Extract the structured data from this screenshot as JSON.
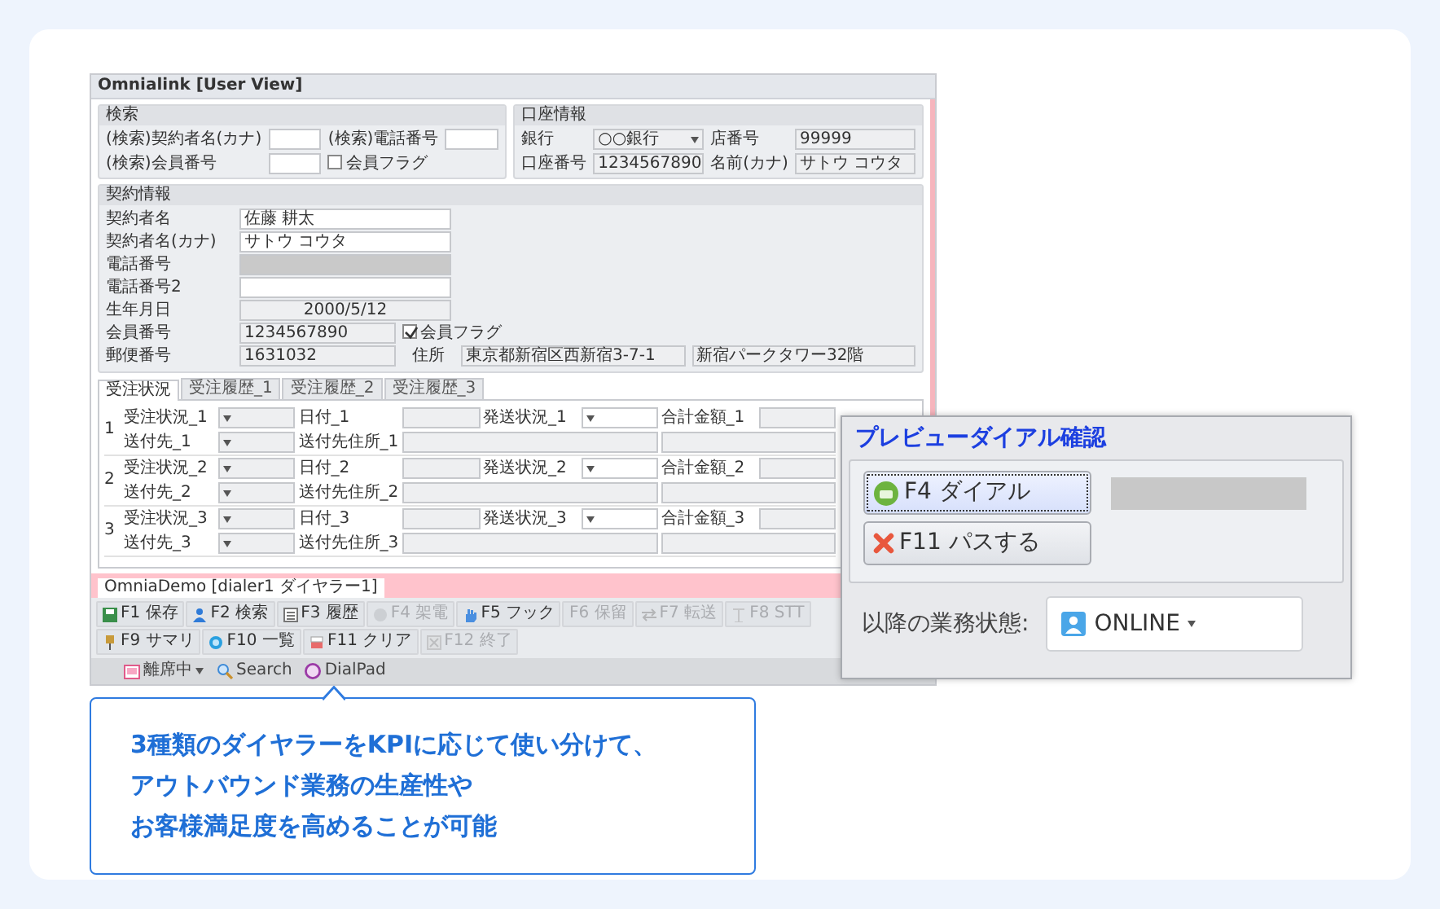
{
  "window": {
    "title": "Omnialink [User View]"
  },
  "search_panel": {
    "title": "検索",
    "fields": [
      {
        "label": "(検索)契約者名(カナ)",
        "kind": "text",
        "disabled": false
      },
      {
        "label": "(検索)電話番号",
        "kind": "text",
        "disabled": false
      },
      {
        "label": "(検索)会員番号",
        "kind": "text",
        "disabled": false
      },
      {
        "label": "会員フラグ",
        "kind": "checkbox",
        "checked": false
      }
    ]
  },
  "account_panel": {
    "title": "口座情報",
    "fields": [
      {
        "label": "銀行",
        "value": "○○銀行",
        "kind": "select",
        "disabled": true
      },
      {
        "label": "店番号",
        "value": "99999",
        "kind": "text",
        "disabled": true
      },
      {
        "label": "口座番号",
        "value": "1234567890",
        "kind": "text",
        "disabled": true
      },
      {
        "label": "名前(カナ)",
        "value": "サトウ コウタ",
        "kind": "text",
        "disabled": true
      }
    ]
  },
  "contract_panel": {
    "title": "契約情報",
    "rows": [
      [
        {
          "label": "契約者名",
          "value": "佐藤 耕太",
          "kind": "text",
          "disabled": false
        }
      ],
      [
        {
          "label": "契約者名(カナ)",
          "value": "サトウ コウタ",
          "kind": "text",
          "disabled": false
        }
      ],
      [
        {
          "label": "電話番号",
          "kind": "text",
          "disabled": true
        }
      ],
      [
        {
          "label": "電話番号2",
          "kind": "text",
          "disabled": false
        }
      ],
      [
        {
          "label": "生年月日",
          "value": "2000/5/12",
          "kind": "date",
          "disabled": true
        }
      ],
      [
        {
          "label": "会員番号",
          "value": "1234567890",
          "kind": "text",
          "disabled": true
        },
        {
          "label": "会員フラグ",
          "kind": "checkbox",
          "checked": true
        }
      ],
      [
        {
          "label": "郵便番号",
          "value": "1631032",
          "kind": "text",
          "disabled": true
        },
        {
          "label": "住所",
          "value": "東京都新宿区西新宿3-7-1",
          "kind": "wide",
          "disabled": true
        },
        {
          "value": "新宿パークタワー32階",
          "kind": "wide",
          "disabled": true
        }
      ]
    ]
  },
  "tabs": [
    {
      "label": "受注状況",
      "selected": true
    },
    {
      "label": "受注履歴_1",
      "selected": false
    },
    {
      "label": "受注履歴_2",
      "selected": false
    },
    {
      "label": "受注履歴_3",
      "selected": false
    }
  ],
  "orders": [
    {
      "number": "1",
      "status": "受注状況_1",
      "date": "日付_1",
      "shipping": "発送状況_1",
      "total": "合計金額_1",
      "dest": "送付先_1",
      "dest_address": "送付先住所_1"
    },
    {
      "number": "2",
      "status": "受注状況_2",
      "date": "日付_2",
      "shipping": "発送状況_2",
      "total": "合計金額_2",
      "dest": "送付先_2",
      "dest_address": "送付先住所_2"
    },
    {
      "number": "3",
      "status": "受注状況_3",
      "date": "日付_3",
      "shipping": "発送状況_3",
      "total": "合計金額_3",
      "dest": "送付先_3",
      "dest_address": "送付先住所_3"
    }
  ],
  "window_tab": {
    "label": "OmniaDemo [dialer1 ダイヤラー1]"
  },
  "toolbar": [
    {
      "label": "F1 保存",
      "disabled": false
    },
    {
      "label": "F2 検索",
      "disabled": false
    },
    {
      "label": "F3 履歴",
      "disabled": false
    },
    {
      "label": "F4 架電",
      "disabled": true
    },
    {
      "label": "F5 フック",
      "disabled": false
    },
    {
      "label": "F6 保留",
      "disabled": true
    },
    {
      "label": "F7 転送",
      "disabled": true
    },
    {
      "label": "F8 STT",
      "disabled": true
    },
    {
      "label": "F9 サマリ",
      "disabled": false
    },
    {
      "label": "F10 一覧",
      "disabled": false
    },
    {
      "label": "F11 クリア",
      "disabled": false
    },
    {
      "label": "F12 終了",
      "disabled": true
    }
  ],
  "status_bar": [
    {
      "label": "離席中",
      "kind": "status"
    },
    {
      "label": "Search",
      "kind": "search"
    },
    {
      "label": "DialPad",
      "kind": "dialpad"
    }
  ],
  "dialog": {
    "title": "プレビューダイアル確認",
    "buttons": [
      {
        "label": "F4 ダイアル",
        "kind": "dial",
        "focused": true
      },
      {
        "label": "F11 パスする",
        "kind": "pass",
        "focused": false
      }
    ],
    "state_label": "以降の業務状態:",
    "state_value": "ONLINE"
  },
  "caption": {
    "lines": [
      "3種類のダイヤラーをKPIに応じて使い分けて、",
      "アウトバウンド業務の生産性や",
      "お客様満足度を高めることが可能"
    ]
  }
}
